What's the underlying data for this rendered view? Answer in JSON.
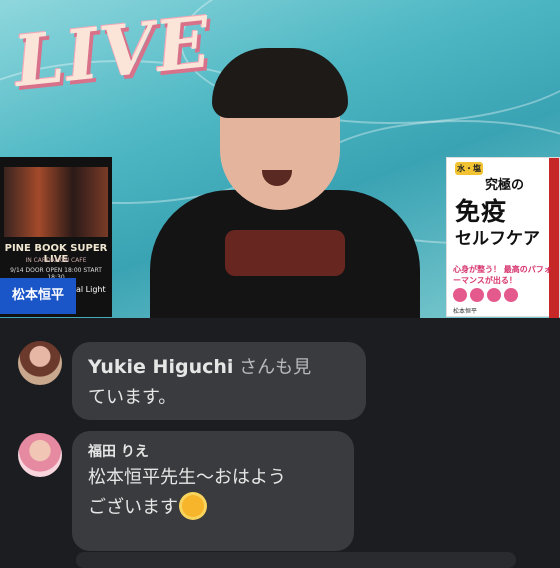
{
  "video": {
    "live_label": "LIVE",
    "host_name_tag": "松本恒平",
    "poster": {
      "title": "PINE BOOK SUPER LIVE",
      "subtitle": "IN CARDAMON CAFE",
      "info": "9/14 DOOR OPEN 18:00 START 18:30",
      "bottom_label": "al Light"
    },
    "book": {
      "tag": "水・塩",
      "title_top": "究極の",
      "title_main": "免疫",
      "title_sub": "セルフケア",
      "highlight": "心身が整う！ 最高のパフォーマンスが出る！",
      "author": "松本恒平"
    }
  },
  "chat": {
    "messages": [
      {
        "sender": "Yukie Higuchi",
        "suffix": "さんも見",
        "line2": "ています。"
      },
      {
        "sender": "福田 りえ",
        "line1": "松本恒平先生〜おはよう",
        "line2": "ございます"
      }
    ]
  }
}
